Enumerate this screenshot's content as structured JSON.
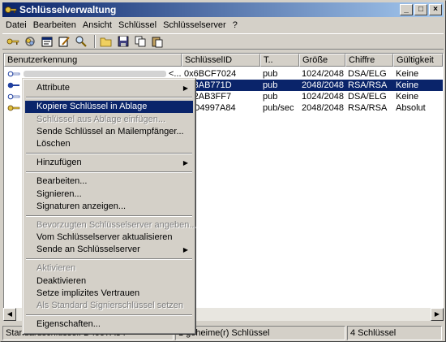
{
  "window": {
    "title": "Schlüsselverwaltung",
    "minimize": "_",
    "maximize": "□",
    "close": "×"
  },
  "menubar": [
    "Datei",
    "Bearbeiten",
    "Ansicht",
    "Schlüssel",
    "Schlüsselserver",
    "?"
  ],
  "toolbar": {
    "icons": [
      "key-icon",
      "key-ring-icon",
      "properties-icon",
      "edit-icon",
      "search-icon",
      "open-folder-icon",
      "save-icon",
      "copy-icon",
      "paste-icon"
    ]
  },
  "columns": [
    "Benutzerkennung",
    "SchlüsselID",
    "T..",
    "Größe",
    "Chiffre",
    "Gültigkeit"
  ],
  "rows": [
    {
      "user_suffix": "<...",
      "key_id": "0x6BCF7024",
      "type": "pub",
      "size": "1024/2048",
      "cipher": "DSA/ELG",
      "validity": "Keine",
      "selected": false
    },
    {
      "user_suffix": "",
      "key_id": "0x3AB771D",
      "type": "pub",
      "size": "2048/2048",
      "cipher": "RSA/RSA",
      "validity": "Keine",
      "selected": true
    },
    {
      "user_suffix": "",
      "key_id": "0x2AB3FF7",
      "type": "pub",
      "size": "1024/2048",
      "cipher": "DSA/ELG",
      "validity": "Keine",
      "selected": false
    },
    {
      "user_suffix": "",
      "key_id": "0xD4997A84",
      "type": "pub/sec",
      "size": "2048/2048",
      "cipher": "RSA/RSA",
      "validity": "Absolut",
      "selected": false
    }
  ],
  "context_menu": {
    "items": [
      {
        "label": "Attribute",
        "submenu": true
      },
      {
        "label": "Kopiere Schlüssel in Ablage",
        "highlighted": true
      },
      {
        "label": "Schlüssel aus Ablage einfügen...",
        "disabled": true
      },
      {
        "label": "Sende Schlüssel an Mailempfänger..."
      },
      {
        "label": "Löschen"
      },
      {
        "label": "Hinzufügen",
        "submenu": true
      },
      {
        "label": "Bearbeiten..."
      },
      {
        "label": "Signieren..."
      },
      {
        "label": "Signaturen anzeigen..."
      },
      {
        "label": "Bevorzugten Schlüsselserver angeben...",
        "disabled": true
      },
      {
        "label": "Vom Schlüsselserver aktualisieren"
      },
      {
        "label": "Sende an Schlüsselserver",
        "submenu": true
      },
      {
        "label": "Aktivieren",
        "disabled": true
      },
      {
        "label": "Deaktivieren"
      },
      {
        "label": "Setze implizites Vertrauen"
      },
      {
        "label": "Als Standard Signierschlüssel setzen",
        "disabled": true
      },
      {
        "label": "Eigenschaften..."
      }
    ],
    "submenu_arrow": "▶"
  },
  "statusbar": {
    "default_key": "Standardschlüssel: D4997A84",
    "selected": "1 geheime(r) Schlüssel",
    "count": "4 Schlüssel"
  },
  "scroll": {
    "left": "◀",
    "right": "▶"
  }
}
